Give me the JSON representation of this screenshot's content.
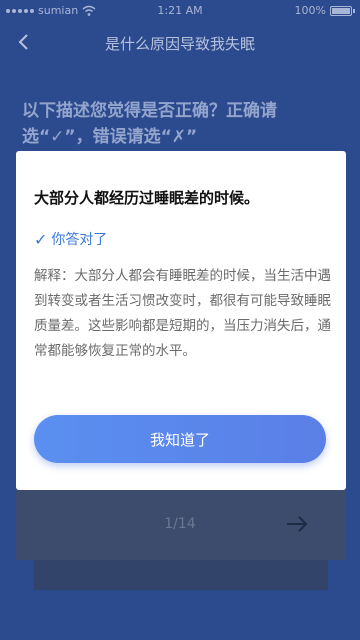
{
  "status_bar": {
    "carrier": "sumian",
    "time": "1:21 AM",
    "battery": "100%",
    "battery_level": 1.0
  },
  "header": {
    "title": "是什么原因导致我失眠"
  },
  "question": {
    "text": "以下描述您觉得是否正确？正确请选“✓”，错误请选“✗”"
  },
  "pagination": {
    "indicator": "1/14"
  },
  "modal": {
    "statement": "大部分人都经历过睡眠差的时候。",
    "result": "你答对了",
    "explanation": "解释：大部分人都会有睡眠差的时候，当生活中遇到转变或者生活习惯改变时，都很有可能导致睡眠质量差。这些影响都是短期的，当压力消失后，通常都能够恢复正常的水平。",
    "button_label": "我知道了"
  },
  "colors": {
    "background": "#2c4a8e",
    "accent": "#3c78d8",
    "button": "#5a8ff0"
  }
}
